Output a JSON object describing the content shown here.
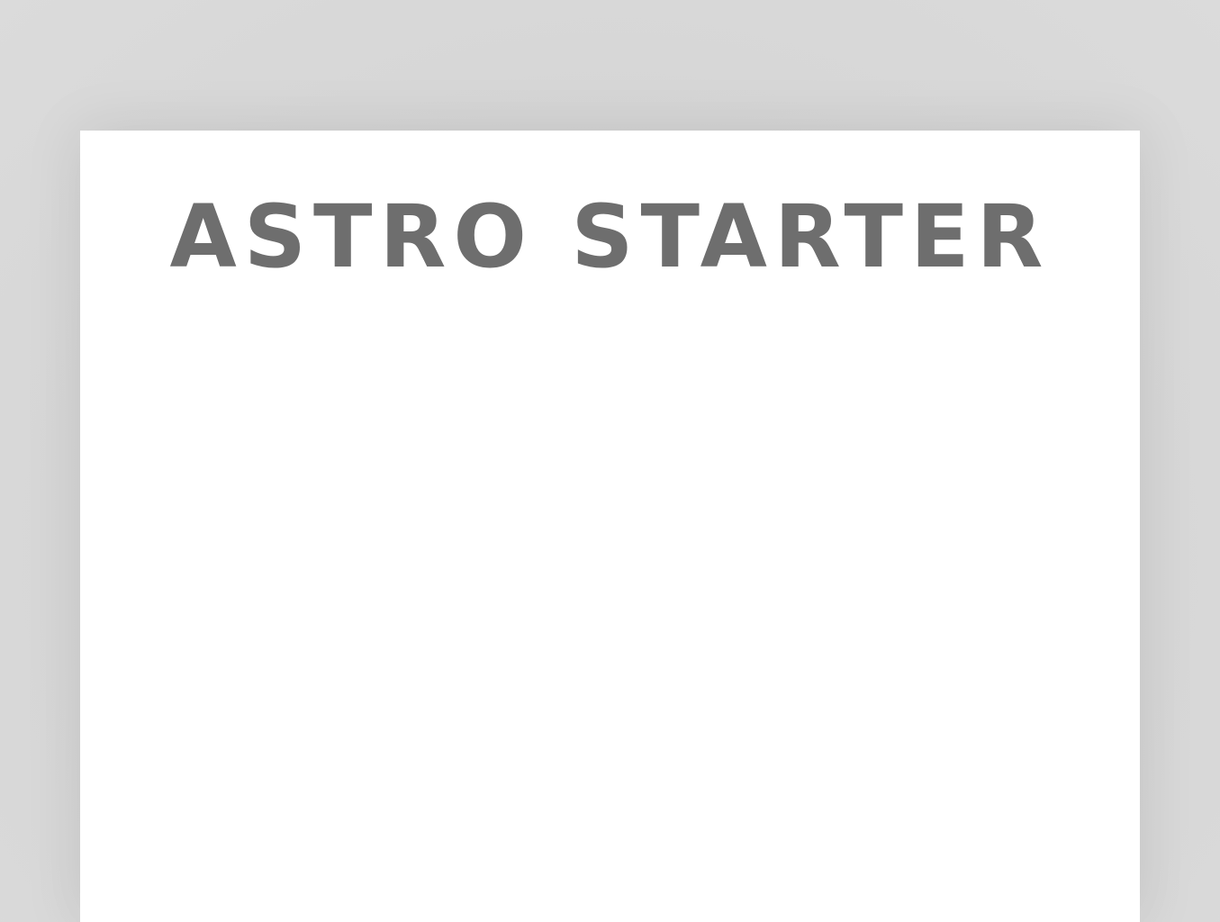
{
  "page": {
    "title": "ASTRO STARTER"
  },
  "colors": {
    "backdrop": "#dadada",
    "sheet": "#ffffff",
    "title_text": "#6e6e6e"
  }
}
